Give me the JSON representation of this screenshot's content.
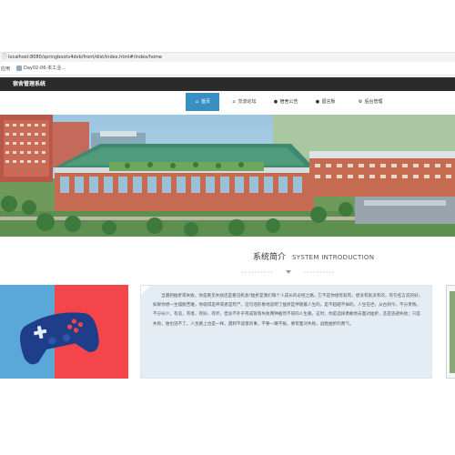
{
  "browser": {
    "url": "localhost:8080/springbootv4dvb/front/dist/index.html#/index/home",
    "bookmark_apps_label": "应用",
    "bookmark_item_label": "Day02-06-本工业..."
  },
  "app": {
    "title": "宿舍管理系统"
  },
  "nav": {
    "items": [
      {
        "label": "首页",
        "icon": "home-icon",
        "active": true
      },
      {
        "label": "交流论坛",
        "icon": "forum-icon",
        "active": false
      },
      {
        "label": "宿舍公告",
        "icon": "notice-icon",
        "active": false
      },
      {
        "label": "留言板",
        "icon": "message-icon",
        "active": false
      },
      {
        "label": "后台管理",
        "icon": "admin-icon",
        "active": false
      }
    ]
  },
  "intro": {
    "title_cn": "系统简介",
    "title_en": "SYSTEM INTRODUCTION",
    "text": "当遇到挫折或失败，你是看见失败还是看见机会?挫折是我们每个人成长的必经之路，它不是你想有就有，想没有就没有的，有句名言说的好，如果你想一生摆脱苦难，你就得是神或者是死尸。这句话形象地说明了挫折是伴随着人生的，是不超越不掉的。人生在世，从古到今，不分贵贱，不分长少，有恶，有善，有好，有坏。但总不外乎有成就和失败两种截然不同的人生路。这时，你是选择勇敢地去面对挫折，还是逃避失败；只是失败，谁也逃不了。人生路上也是一样，遇到不适意的事，不要一蹶不振，要有面对失败，战胜挫折的勇气。"
  },
  "colors": {
    "appbar_bg": "#2b2b2b",
    "nav_active_bg": "#3a8fc2",
    "intro_card_bg": "#e4edf3",
    "game_card_left": "#5aa8d8",
    "game_card_right": "#f4454a"
  }
}
